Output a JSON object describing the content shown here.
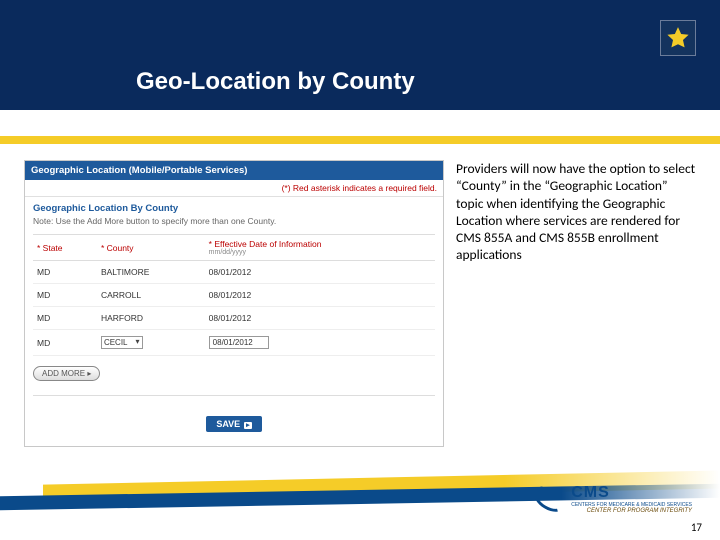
{
  "title": "Geo-Location by County",
  "star_icon": "star",
  "screenshot": {
    "header": "Geographic Location (Mobile/Portable Services)",
    "required_note": "(*) Red asterisk indicates a required field.",
    "sub_header": "Geographic Location By County",
    "note": "Note: Use the Add More button to specify more than one County.",
    "columns": {
      "state": "* State",
      "county": "* County",
      "date": "* Effective Date of Information",
      "date_fmt": "mm/dd/yyyy"
    },
    "rows": [
      {
        "state": "MD",
        "county": "BALTIMORE",
        "date": "08/01/2012"
      },
      {
        "state": "MD",
        "county": "CARROLL",
        "date": "08/01/2012"
      },
      {
        "state": "MD",
        "county": "HARFORD",
        "date": "08/01/2012"
      }
    ],
    "editable_row": {
      "state": "MD",
      "county_selected": "CECIL",
      "date_value": "08/01/2012"
    },
    "add_more_label": "ADD MORE ▸",
    "save_label": "SAVE"
  },
  "description": "Providers will now have the option to select “County” in the “Geographic Location” topic when identifying the Geographic Location where services are rendered for CMS 855A and CMS 855B enrollment applications",
  "logo": {
    "acronym": "CMS",
    "tagline": "CENTERS FOR MEDICARE & MEDICAID SERVICES",
    "subline": "CENTER FOR PROGRAM INTEGRITY"
  },
  "page_number": "17"
}
